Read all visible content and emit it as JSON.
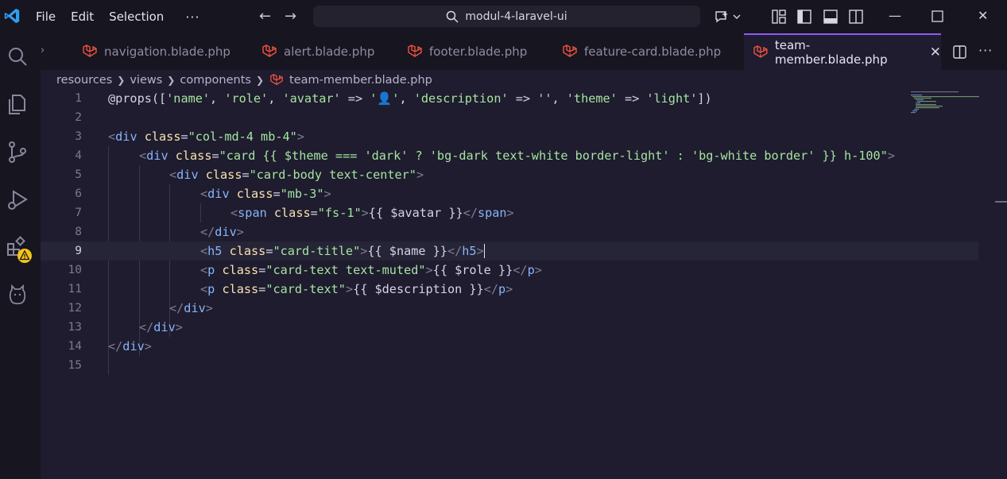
{
  "menu": {
    "file": "File",
    "edit": "Edit",
    "selection": "Selection",
    "more": "···"
  },
  "search": {
    "text": "modul-4-laravel-ui"
  },
  "tabs": [
    {
      "label": "navigation.blade.php"
    },
    {
      "label": "alert.blade.php"
    },
    {
      "label": "footer.blade.php"
    },
    {
      "label": "feature-card.blade.php"
    },
    {
      "label": "team-member.blade.php",
      "active": true
    }
  ],
  "tab_close": "✕",
  "breadcrumb": [
    "resources",
    "views",
    "components",
    "team-member.blade.php"
  ],
  "colors": {
    "accent": "#8b5cf6",
    "laravel": "#f05340",
    "warning": "#f5c518"
  },
  "icons": {
    "activity": [
      "search-icon",
      "explorer-icon",
      "source-control-icon",
      "run-debug-icon",
      "extensions-icon",
      "cat-icon"
    ],
    "tab_actions": [
      "split-editor-icon",
      "more-actions-icon"
    ]
  },
  "editor": {
    "current_line": 9,
    "lines": [
      {
        "n": "1"
      },
      {
        "n": "2"
      },
      {
        "n": "3"
      },
      {
        "n": "4"
      },
      {
        "n": "5"
      },
      {
        "n": "6"
      },
      {
        "n": "7"
      },
      {
        "n": "8"
      },
      {
        "n": "9"
      },
      {
        "n": "10"
      },
      {
        "n": "11"
      },
      {
        "n": "12"
      },
      {
        "n": "13"
      },
      {
        "n": "14"
      },
      {
        "n": "15"
      }
    ],
    "code": {
      "l1": [
        "@props([",
        "'name'",
        ", ",
        "'role'",
        ", ",
        "'avatar'",
        " => ",
        "'👤'",
        ", ",
        "'description'",
        " => ",
        "''",
        ", ",
        "'theme'",
        " => ",
        "'light'",
        "])"
      ],
      "l3": [
        "<",
        "div",
        " ",
        "class",
        "=",
        "\"col-md-4 mb-4\"",
        ">"
      ],
      "l4": [
        "<",
        "div",
        " ",
        "class",
        "=",
        "\"card {{ $theme === 'dark' ? 'bg-dark text-white border-light' : 'bg-white border' }} h-100\"",
        ">"
      ],
      "l5": [
        "<",
        "div",
        " ",
        "class",
        "=",
        "\"card-body text-center\"",
        ">"
      ],
      "l6": [
        "<",
        "div",
        " ",
        "class",
        "=",
        "\"mb-3\"",
        ">"
      ],
      "l7": [
        "<",
        "span",
        " ",
        "class",
        "=",
        "\"fs-1\"",
        ">",
        "{{ $avatar }}",
        "</",
        "span",
        ">"
      ],
      "l8": [
        "</",
        "div",
        ">"
      ],
      "l9": [
        "<",
        "h5",
        " ",
        "class",
        "=",
        "\"card-title\"",
        ">",
        "{{ $name }}",
        "</",
        "h5",
        ">"
      ],
      "l10": [
        "<",
        "p",
        " ",
        "class",
        "=",
        "\"card-text text-muted\"",
        ">",
        "{{ $role }}",
        "</",
        "p",
        ">"
      ],
      "l11": [
        "<",
        "p",
        " ",
        "class",
        "=",
        "\"card-text\"",
        ">",
        "{{ $description }}",
        "</",
        "p",
        ">"
      ],
      "l12": [
        "</",
        "div",
        ">"
      ],
      "l13": [
        "</",
        "div",
        ">"
      ],
      "l14": [
        "</",
        "div",
        ">"
      ]
    }
  }
}
